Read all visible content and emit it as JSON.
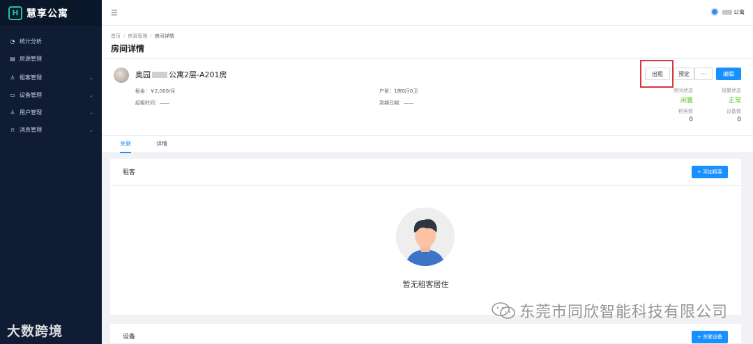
{
  "sidebar": {
    "logo_mark": "H",
    "logo_text": "慧享公寓",
    "items": [
      {
        "icon": "pie-icon",
        "glyph": "◔",
        "label": "统计分析",
        "has_arrow": false
      },
      {
        "icon": "house-icon",
        "glyph": "▤",
        "label": "房源管理",
        "has_arrow": false
      },
      {
        "icon": "person-icon",
        "glyph": "♙",
        "label": "租客管理",
        "has_arrow": true
      },
      {
        "icon": "monitor-icon",
        "glyph": "▭",
        "label": "设备管理",
        "has_arrow": true
      },
      {
        "icon": "user-icon",
        "glyph": "♙",
        "label": "用户管理",
        "has_arrow": true
      },
      {
        "icon": "bell-icon",
        "glyph": "⍾",
        "label": "消息管理",
        "has_arrow": true
      }
    ],
    "watermark": "大数跨境"
  },
  "header": {
    "collapse_glyph": "☰",
    "user_name": "公寓"
  },
  "breadcrumb": [
    "首页",
    "房源管理",
    "房间详情"
  ],
  "page_title": "房间详情",
  "room": {
    "name_prefix": "奥园",
    "name_suffix": "公寓2层-A201房",
    "rent_label": "租金：",
    "rent_value": "￥2,000/月",
    "start_label": "起租时间：",
    "start_value": "——",
    "layout_label": "户型：",
    "layout_value": "1房0厅0卫",
    "end_label": "到期日期：",
    "end_value": "——",
    "buttons": {
      "rent": "出租",
      "reserve": "预定",
      "more": "···",
      "edit": "编辑"
    },
    "stats": {
      "room_status_label": "房间状态",
      "room_status_value": "闲置",
      "alarm_status_label": "报警状态",
      "alarm_status_value": "正常",
      "tenant_count_label": "租客数",
      "tenant_count_value": "0",
      "device_count_label": "设备数",
      "device_count_value": "0"
    },
    "colors": {
      "green": "#52c41a",
      "highlight": "#d9363e"
    }
  },
  "tabs": [
    {
      "label": "关联",
      "active": true
    },
    {
      "label": "详情",
      "active": false
    }
  ],
  "tenant_card": {
    "title": "租客",
    "add_button": "+ 添加租客",
    "empty_text": "暂无租客居住"
  },
  "device_card": {
    "title": "设备",
    "link_button": "+ 关联设备"
  },
  "watermark_right": "东莞市同欣智能科技有限公司",
  "accent": "#1890ff"
}
